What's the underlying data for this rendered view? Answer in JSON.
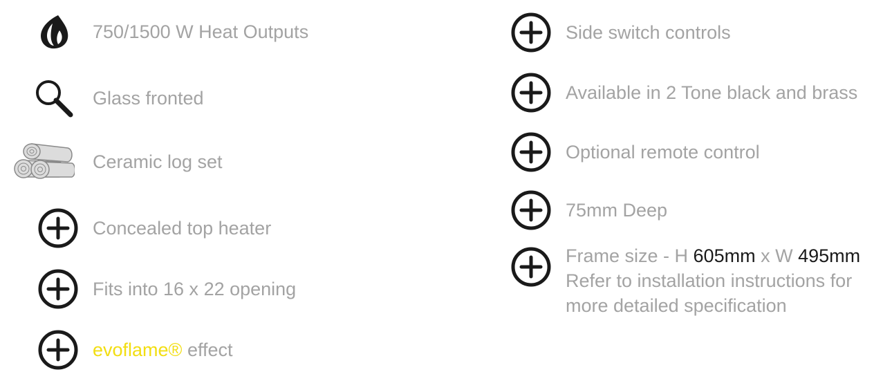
{
  "colors": {
    "text": "#a3a3a3",
    "icon": "#1a1a1a",
    "highlight_yellow": "#f2de12",
    "highlight_black": "#1a1a1a"
  },
  "left_column": [
    {
      "icon": "flame-icon",
      "label": "750/1500 W Heat Outputs"
    },
    {
      "icon": "magnifier-icon",
      "label": "Glass fronted"
    },
    {
      "icon": "logs-icon",
      "label": "Ceramic log set"
    },
    {
      "icon": "plus-circle-icon",
      "label": "Concealed top heater"
    },
    {
      "icon": "plus-circle-icon",
      "label": "Fits into 16 x 22 opening"
    },
    {
      "icon": "plus-circle-icon",
      "label_brand": "evoflame®",
      "label_rest": " effect"
    }
  ],
  "right_column": [
    {
      "icon": "plus-circle-icon",
      "label": "Side switch controls"
    },
    {
      "icon": "plus-circle-icon",
      "label": "Available in 2 Tone black and brass"
    },
    {
      "icon": "plus-circle-icon",
      "label": "Optional remote control"
    },
    {
      "icon": "plus-circle-icon",
      "label": "75mm Deep"
    },
    {
      "icon": "plus-circle-icon",
      "frame_prefix": "Frame size - H ",
      "frame_h": "605mm",
      "frame_mid": " x W ",
      "frame_w": "495mm",
      "line2": "Refer to installation instructions for",
      "line3": "more detailed specification"
    }
  ]
}
